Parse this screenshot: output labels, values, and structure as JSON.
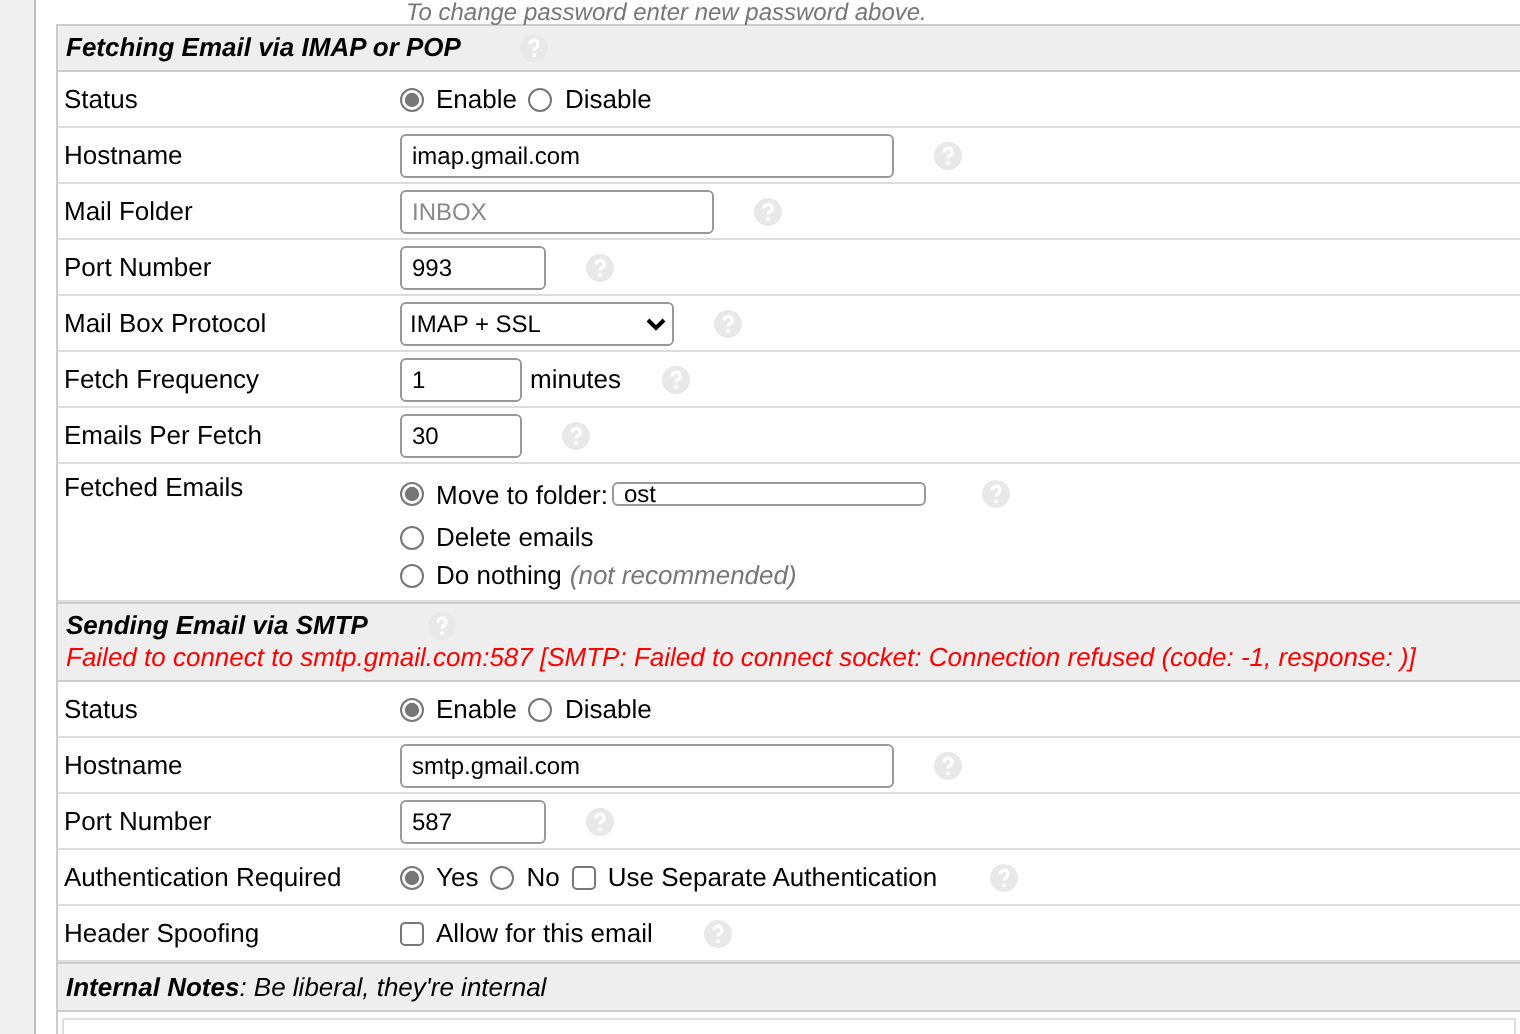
{
  "notice": "To change password enter new password above.",
  "sections": [
    {
      "title": "Fetching Email via IMAP or POP",
      "help": true,
      "rows": [
        {
          "label": "Status",
          "kind": "radio",
          "options": [
            {
              "label": "Enable",
              "selected": true
            },
            {
              "label": "Disable",
              "selected": false
            }
          ]
        },
        {
          "label": "Hostname",
          "kind": "long_text",
          "value": "imap.gmail.com",
          "help": true
        },
        {
          "label": "Mail Folder",
          "kind": "medium_text",
          "placeholder": "INBOX",
          "help": true
        },
        {
          "label": "Port Number",
          "kind": "short_text",
          "value": "993",
          "help": true
        },
        {
          "label": "Mail Box Protocol",
          "kind": "select",
          "value": "IMAP + SSL",
          "help": true
        },
        {
          "label": "Fetch Frequency",
          "kind": "tiny_text",
          "value": "1",
          "suffix": "minutes",
          "help": true
        },
        {
          "label": "Emails Per Fetch",
          "kind": "tiny_text",
          "value": "30",
          "help": true
        },
        {
          "label": "Fetched Emails",
          "kind": "radio_list",
          "help": true,
          "options": [
            {
              "label": "Move to folder:",
              "selected": true,
              "field": "ost"
            },
            {
              "label": "Delete emails",
              "selected": false
            },
            {
              "label": "Do nothing",
              "note": "(not recommended)",
              "selected": false
            }
          ]
        }
      ]
    },
    {
      "title": "Sending Email via SMTP",
      "help": true,
      "error": "Failed to connect to smtp.gmail.com:587 [SMTP: Failed to connect socket: Connection refused (code: -1, response: )]",
      "rows": [
        {
          "label": "Status",
          "kind": "radio",
          "options": [
            {
              "label": "Enable",
              "selected": true
            },
            {
              "label": "Disable",
              "selected": false
            }
          ]
        },
        {
          "label": "Hostname",
          "kind": "long_text",
          "value": "smtp.gmail.com",
          "help": true
        },
        {
          "label": "Port Number",
          "kind": "short_text",
          "value": "587",
          "help": true
        },
        {
          "label": "Authentication Required",
          "kind": "radio",
          "help": true,
          "options": [
            {
              "label": "Yes",
              "selected": true
            },
            {
              "label": "No",
              "selected": false
            }
          ],
          "checkbox": {
            "label": "Use Separate Authentication",
            "checked": false
          }
        },
        {
          "label": "Header Spoofing",
          "kind": "checkbox",
          "help": true,
          "checkbox": {
            "label": "Allow for this email",
            "checked": false
          }
        }
      ]
    }
  ],
  "notes": {
    "title": "**Internal Notes**: Be liberal, they're internal"
  }
}
